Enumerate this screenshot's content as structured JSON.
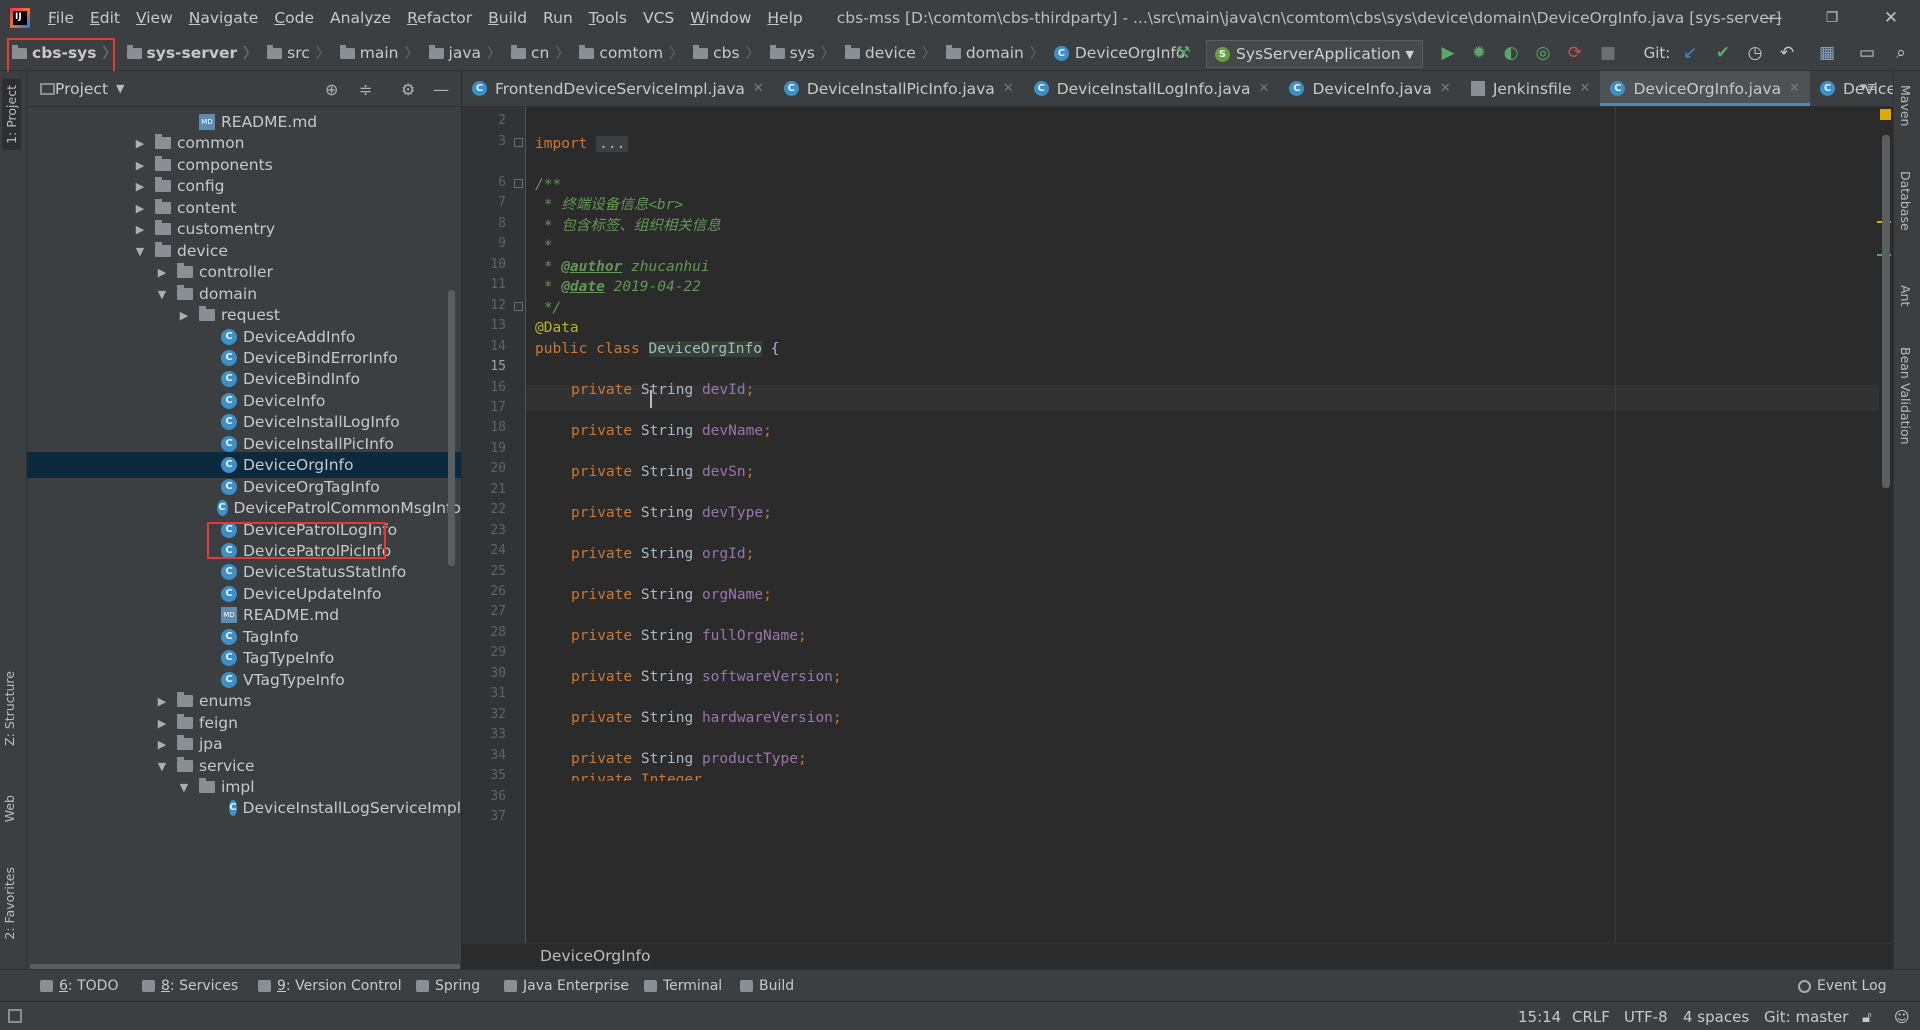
{
  "window": {
    "title": "cbs-mss [D:\\comtom\\cbs-thirdparty] - ...\\src\\main\\java\\cn\\comtom\\cbs\\sys\\device\\domain\\DeviceOrgInfo.java [sys-server]",
    "minimize": "—",
    "restore": "❐",
    "close": "✕"
  },
  "menu": [
    {
      "m": "F",
      "rest": "ile"
    },
    {
      "m": "E",
      "rest": "dit"
    },
    {
      "m": "V",
      "rest": "iew"
    },
    {
      "m": "N",
      "rest": "avigate"
    },
    {
      "m": "C",
      "rest": "ode"
    },
    {
      "m": "",
      "rest": "Analyze"
    },
    {
      "m": "R",
      "rest": "efactor"
    },
    {
      "m": "B",
      "rest": "uild"
    },
    {
      "m": "",
      "rest": "Run"
    },
    {
      "m": "T",
      "rest": "ools"
    },
    {
      "m": "",
      "rest": "VCS"
    },
    {
      "m": "W",
      "rest": "indow"
    },
    {
      "m": "H",
      "rest": "elp"
    }
  ],
  "breadcrumb": [
    "cbs-sys",
    "sys-server",
    "src",
    "main",
    "java",
    "cn",
    "comtom",
    "cbs",
    "sys",
    "device",
    "domain",
    "DeviceOrgInfo"
  ],
  "toolbar": {
    "run_config": "SysServerApplication",
    "git_label": "Git:"
  },
  "project_panel": {
    "title": "Project"
  },
  "tree": [
    {
      "label": "README.md",
      "type": "md",
      "depth": 2,
      "arrow": ""
    },
    {
      "label": "common",
      "type": "folder",
      "depth": 1,
      "arrow": "▶"
    },
    {
      "label": "components",
      "type": "folder",
      "depth": 1,
      "arrow": "▶"
    },
    {
      "label": "config",
      "type": "folder",
      "depth": 1,
      "arrow": "▶"
    },
    {
      "label": "content",
      "type": "folder",
      "depth": 1,
      "arrow": "▶"
    },
    {
      "label": "customentry",
      "type": "folder",
      "depth": 1,
      "arrow": "▶"
    },
    {
      "label": "device",
      "type": "folder",
      "depth": 1,
      "arrow": "▼"
    },
    {
      "label": "controller",
      "type": "folder",
      "depth": 2,
      "arrow": "▶"
    },
    {
      "label": "domain",
      "type": "folder",
      "depth": 2,
      "arrow": "▼"
    },
    {
      "label": "request",
      "type": "folder",
      "depth": 3,
      "arrow": "▶"
    },
    {
      "label": "DeviceAddInfo",
      "type": "class",
      "depth": 4,
      "arrow": ""
    },
    {
      "label": "DeviceBindErrorInfo",
      "type": "class",
      "depth": 4,
      "arrow": ""
    },
    {
      "label": "DeviceBindInfo",
      "type": "class",
      "depth": 4,
      "arrow": ""
    },
    {
      "label": "DeviceInfo",
      "type": "class",
      "depth": 4,
      "arrow": ""
    },
    {
      "label": "DeviceInstallLogInfo",
      "type": "class",
      "depth": 4,
      "arrow": ""
    },
    {
      "label": "DeviceInstallPicInfo",
      "type": "class",
      "depth": 4,
      "arrow": ""
    },
    {
      "label": "DeviceOrgInfo",
      "type": "class",
      "depth": 4,
      "arrow": "",
      "selected": true
    },
    {
      "label": "DeviceOrgTagInfo",
      "type": "class",
      "depth": 4,
      "arrow": ""
    },
    {
      "label": "DevicePatrolCommonMsgInfo",
      "type": "class",
      "depth": 4,
      "arrow": ""
    },
    {
      "label": "DevicePatrolLogInfo",
      "type": "class",
      "depth": 4,
      "arrow": ""
    },
    {
      "label": "DevicePatrolPicInfo",
      "type": "class",
      "depth": 4,
      "arrow": ""
    },
    {
      "label": "DeviceStatusStatInfo",
      "type": "class",
      "depth": 4,
      "arrow": ""
    },
    {
      "label": "DeviceUpdateInfo",
      "type": "class",
      "depth": 4,
      "arrow": ""
    },
    {
      "label": "README.md",
      "type": "md",
      "depth": 4,
      "arrow": ""
    },
    {
      "label": "TagInfo",
      "type": "class",
      "depth": 4,
      "arrow": ""
    },
    {
      "label": "TagTypeInfo",
      "type": "class",
      "depth": 4,
      "arrow": ""
    },
    {
      "label": "VTagTypeInfo",
      "type": "class",
      "depth": 4,
      "arrow": ""
    },
    {
      "label": "enums",
      "type": "folder",
      "depth": 2,
      "arrow": "▶"
    },
    {
      "label": "feign",
      "type": "folder",
      "depth": 2,
      "arrow": "▶"
    },
    {
      "label": "jpa",
      "type": "folder",
      "depth": 2,
      "arrow": "▶"
    },
    {
      "label": "service",
      "type": "folder",
      "depth": 2,
      "arrow": "▼"
    },
    {
      "label": "impl",
      "type": "folder",
      "depth": 3,
      "arrow": "▼"
    },
    {
      "label": "DeviceInstallLogServiceImpl",
      "type": "class",
      "depth": 5,
      "arrow": ""
    }
  ],
  "editor_tabs": [
    {
      "label": "FrontendDeviceServiceImpl.java",
      "icon": "class",
      "closable": true
    },
    {
      "label": "DeviceInstallPicInfo.java",
      "icon": "class",
      "closable": true
    },
    {
      "label": "DeviceInstallLogInfo.java",
      "icon": "class",
      "closable": true
    },
    {
      "label": "DeviceInfo.java",
      "icon": "class",
      "closable": true
    },
    {
      "label": "Jenkinsfile",
      "icon": "file",
      "closable": true
    },
    {
      "label": "DeviceOrgInfo.java",
      "icon": "class",
      "closable": true,
      "active": true
    },
    {
      "label": "DeviceOrg",
      "icon": "class",
      "closable": false
    }
  ],
  "line_numbers": [
    "2",
    "3",
    "6",
    "7",
    "8",
    "9",
    "10",
    "11",
    "12",
    "13",
    "14",
    "15",
    "16",
    "17",
    "18",
    "19",
    "20",
    "21",
    "22",
    "23",
    "24",
    "25",
    "26",
    "27",
    "28",
    "29",
    "30",
    "31",
    "32",
    "33",
    "34",
    "35",
    "36",
    "37"
  ],
  "current_line": "15",
  "code": {
    "import_kw": "import",
    "import_folded": "...",
    "doc_open": "/**",
    "doc_line1": " * 终端设备信息<br>",
    "doc_line2": " * 包含标签、组织相关信息",
    "doc_blank": " *",
    "author_prefix": " * ",
    "author_tag": "@author",
    "author_value": " zhucanhui",
    "date_tag": "@date",
    "date_value": " 2019-04-22",
    "doc_close": " */",
    "annotation": "@Data",
    "class_kw": "public class ",
    "class_name": "DeviceOrgInfo",
    "class_brace": " {",
    "field_kw": "private ",
    "field_type": "String ",
    "fields": [
      "devId",
      "devName",
      "devSn",
      "devType",
      "orgId",
      "orgName",
      "fullOrgName",
      "softwareVersion",
      "hardwareVersion",
      "productType"
    ],
    "partial_line": "private Integer ..."
  },
  "bottom_breadcrumb": "DeviceOrgInfo",
  "tool_windows": [
    {
      "num": "6",
      "label": ": TODO"
    },
    {
      "num": "8",
      "label": ": Services"
    },
    {
      "num": "9",
      "label": ": Version Control"
    },
    {
      "num": "",
      "label": "Spring"
    },
    {
      "num": "",
      "label": "Java Enterprise"
    },
    {
      "num": "",
      "label": "Terminal"
    },
    {
      "num": "",
      "label": "Build"
    }
  ],
  "event_log": "Event Log",
  "status": {
    "position": "15:14",
    "line_sep": "CRLF",
    "encoding": "UTF-8",
    "indent": "4 spaces",
    "git_branch": "Git: master"
  },
  "side_tabs": {
    "left": [
      "1: Project",
      "Z: Structure",
      "Web",
      "2: Favorites"
    ],
    "right": [
      "Maven",
      "Database",
      "Ant",
      "Bean Validation"
    ]
  },
  "colors": {
    "highlight_box": "#e53935",
    "accent": "#4a88c7",
    "selection": "#0d293e"
  }
}
